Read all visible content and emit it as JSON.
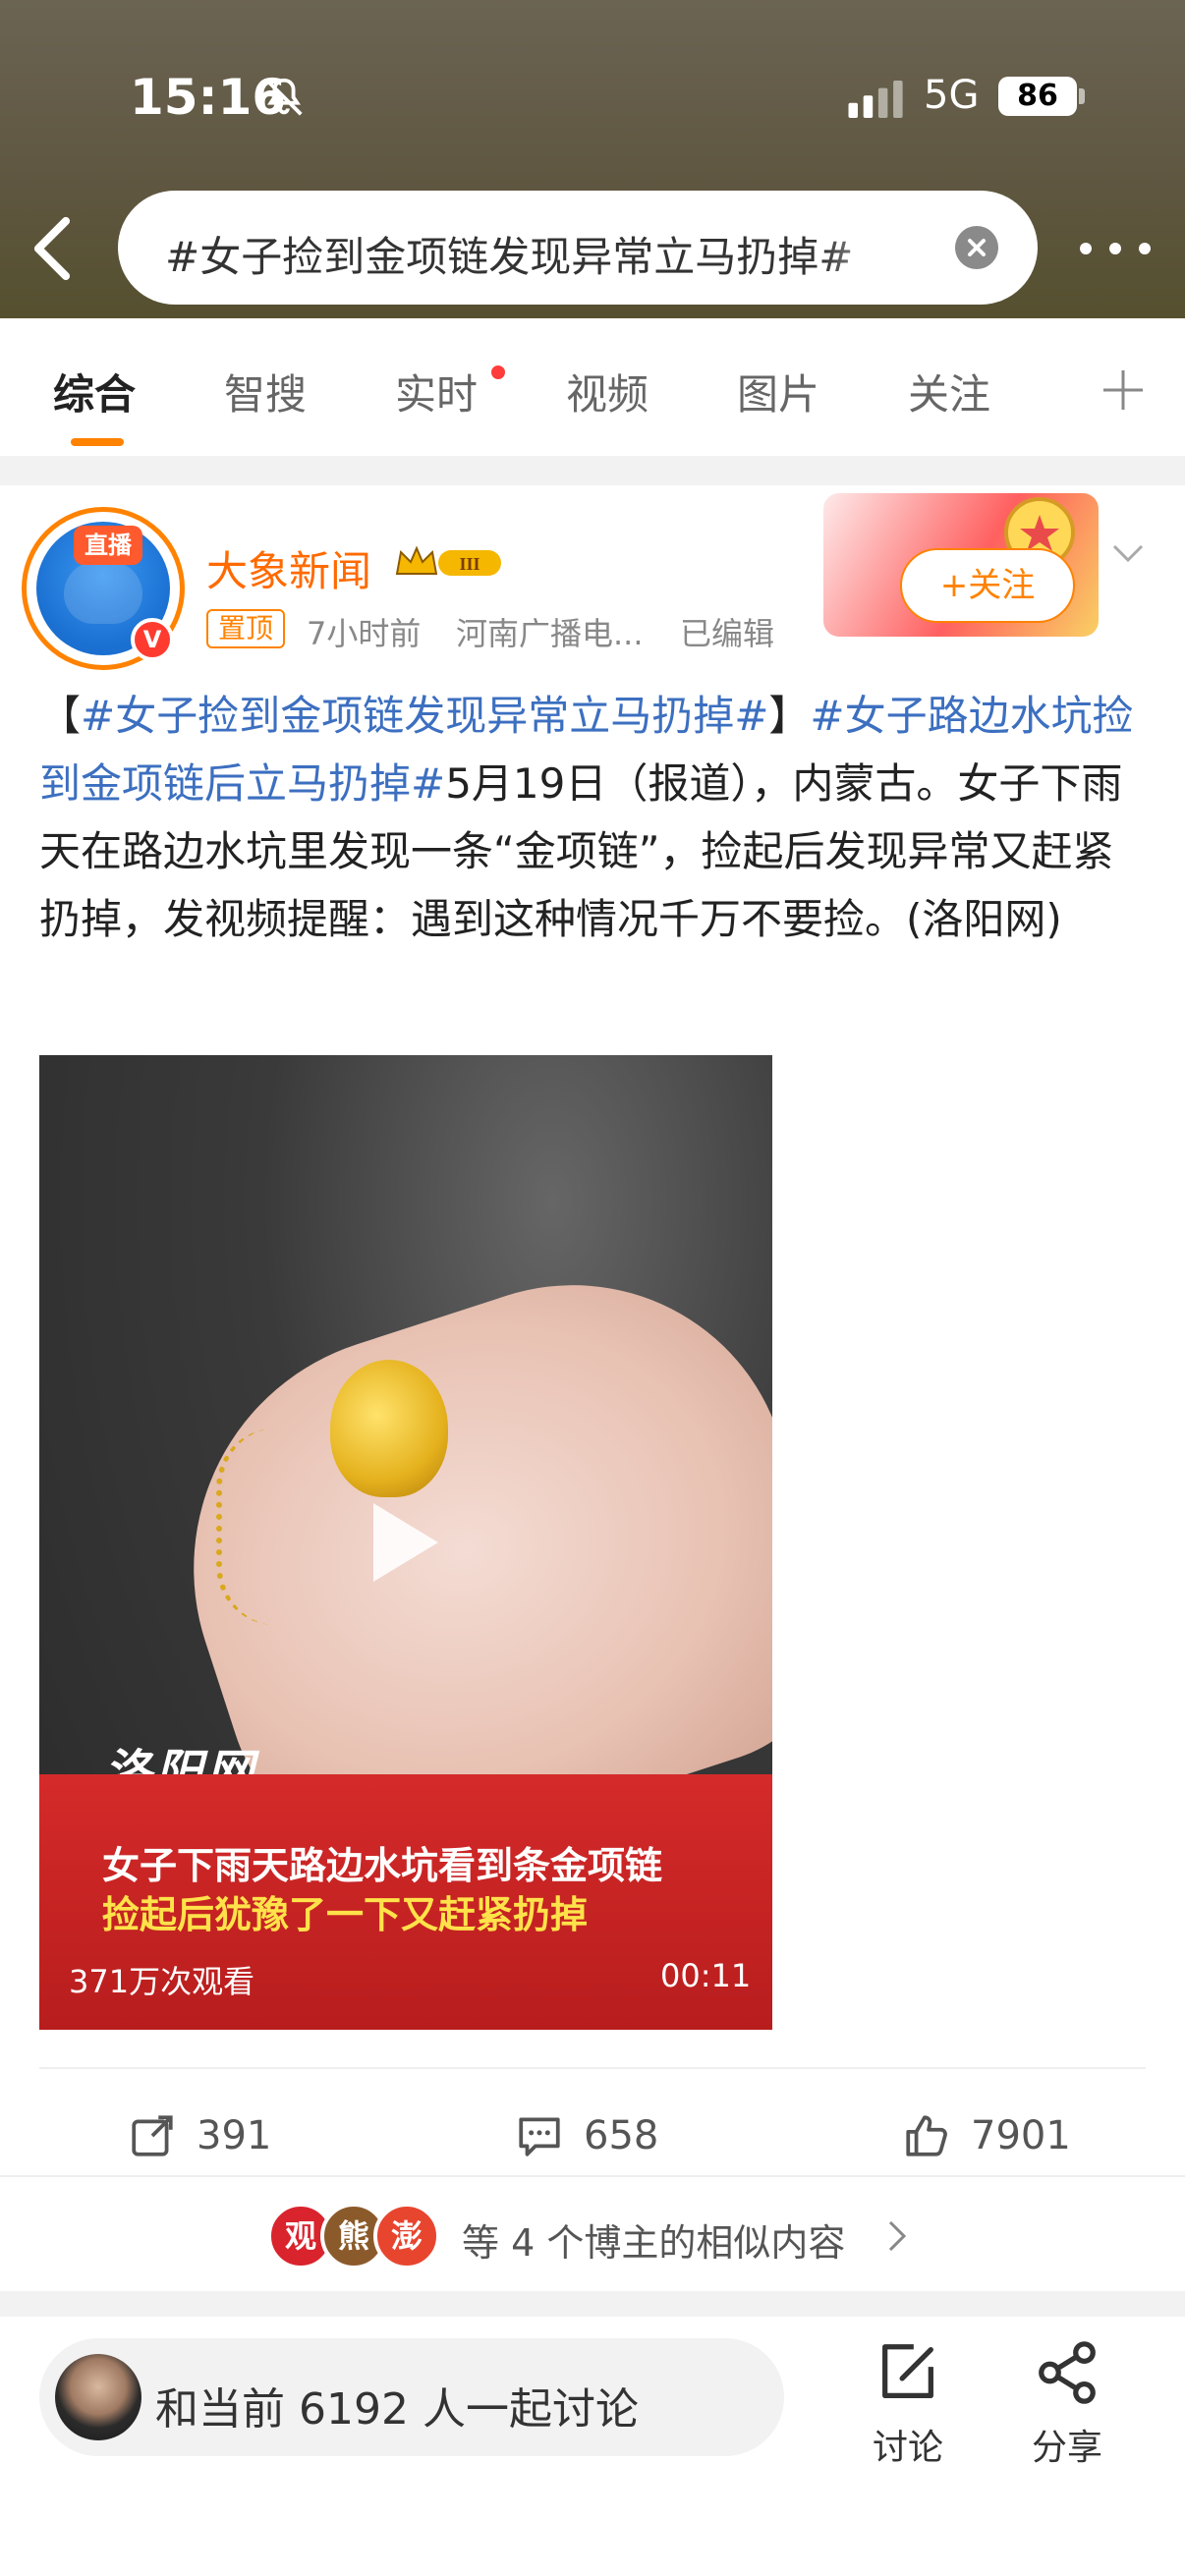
{
  "status_bar": {
    "time": "15:16",
    "network": "5G",
    "battery": "86"
  },
  "search": {
    "query": "#女子捡到金项链发现异常立马扔掉#"
  },
  "tabs": [
    {
      "label": "综合",
      "active": true
    },
    {
      "label": "智搜"
    },
    {
      "label": "实时",
      "has_dot": true
    },
    {
      "label": "视频"
    },
    {
      "label": "图片"
    },
    {
      "label": "关注"
    }
  ],
  "post": {
    "author": "大象新闻",
    "live_badge": "直播",
    "verified_badge": "V",
    "pinned_label": "置顶",
    "time": "7小时前",
    "source": "河南广播电...",
    "edited": "已编辑",
    "follow_label": "+关注",
    "text_parts": {
      "open_bracket": "【",
      "tag1": "#女子捡到金项链发现异常立马扔掉#",
      "close_bracket": "】",
      "tag2": "#女子路边水坑捡到金项链后立马扔掉#",
      "body": "5月19日（报道），内蒙古。女子下雨天在路边水坑里发现一条“金项链”，捡起后发现异常又赶紧扔掉，发视频提醒：遇到这种情况千万不要捡。(洛阳网)"
    },
    "video": {
      "watermark": "洛阳网",
      "banner_line1": "女子下雨天路边水坑看到条金项链",
      "banner_line2": "捡起后犹豫了一下又赶紧扔掉",
      "views": "371万次观看",
      "duration": "00:11"
    },
    "actions": {
      "reposts": "391",
      "comments": "658",
      "likes": "7901"
    },
    "similar": {
      "text": "等 4 个博主的相似内容",
      "logos": [
        "观",
        "熊",
        "澎"
      ]
    }
  },
  "bottom_bar": {
    "placeholder": "和当前 6192 人一起讨论",
    "discuss_label": "讨论",
    "share_label": "分享"
  },
  "colors": {
    "accent": "#ff8200",
    "hashtag": "#3c6fc0",
    "banner_red": "#c52222"
  }
}
